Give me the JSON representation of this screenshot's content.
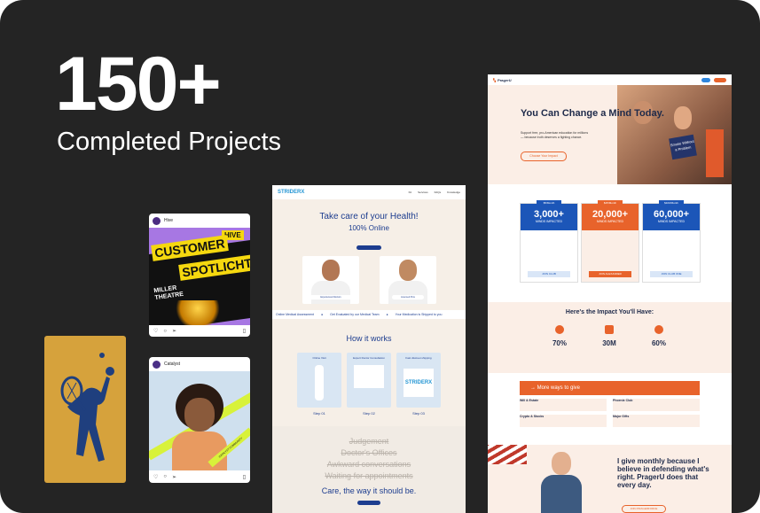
{
  "hero": {
    "number": "150+",
    "subtitle": "Completed Projects"
  },
  "post1": {
    "account": "Hive",
    "brand": "HIVE",
    "headline1": "CUSTOMER",
    "headline2": "SPOTLICHT",
    "venue1": "MILLER",
    "venue2": "THEATRE"
  },
  "post2": {
    "account": "Catalyst",
    "ribbon": "CATALYST COMMUNITY"
  },
  "site1": {
    "logo": "STRIDERX",
    "nav_links": [
      "Kit",
      "Services",
      "FAQs",
      "Knowledge"
    ],
    "title": "Take care of your Health!",
    "subtitle": "100% Online",
    "doctor1_tag": "Experienced Doctors",
    "doctor2_tag": "Licensed Pros",
    "band_items": [
      "Online Medical Assessment",
      "Get Evaluated by our Medical Team",
      "Your Medication is Shipped to you"
    ],
    "how_title": "How it works",
    "steps": [
      {
        "name": "Online Visit",
        "label": "Step 01"
      },
      {
        "name": "Expert Doctor Consultation",
        "label": "Step 02"
      },
      {
        "name": "Fast discreet shipping",
        "label": "Step 03"
      }
    ],
    "step3_logo": "STRIDERX",
    "struck": [
      "Judgement",
      "Doctor's Offices",
      "Awkward conversations",
      "Waiting for appointments"
    ],
    "care_line": "Care, the way it should be."
  },
  "site2": {
    "logo": "PragerU",
    "hero_title": "You Can Change a Mind Today.",
    "hero_desc": "Support free, pro-American education for millions — because truth deserves a fighting chance.",
    "hero_button": "Choose Your Impact",
    "book_text": "Smoke Without a Problem",
    "plans": [
      {
        "price": "$5/Month",
        "count": "3,000+",
        "caption": "MINDS IMPACTED",
        "button": "JOIN CLUB",
        "color": "#1c56b8"
      },
      {
        "price": "$25/Month",
        "count": "20,000+",
        "caption": "MINDS IMPACTED",
        "button": "JOIN ALEXANDER",
        "color": "#e8632b"
      },
      {
        "price": "$100/Month",
        "count": "60,000+",
        "caption": "MINDS IMPACTED",
        "button": "JOIN CLUB ONE",
        "color": "#1c56b8"
      }
    ],
    "impact_title": "Here's the Impact You'll Have:",
    "stats": [
      "70%",
      "30M",
      "60%"
    ],
    "more_ways": "More ways to give",
    "give_items": [
      "Will & Estate",
      "Phoenix Club",
      "Crypto & Stocks",
      "Major Gifts"
    ],
    "quote": "I give monthly because I believe in defending what's right. PragerU does that every day.",
    "quote_button": "JOIN PRAGERFORCE"
  },
  "colors": {
    "background": "#242424",
    "gold": "#d6a23c",
    "navy": "#1d3d8f",
    "orange": "#e8632b",
    "yellow": "#f5d80f",
    "purple": "#a777e3"
  }
}
